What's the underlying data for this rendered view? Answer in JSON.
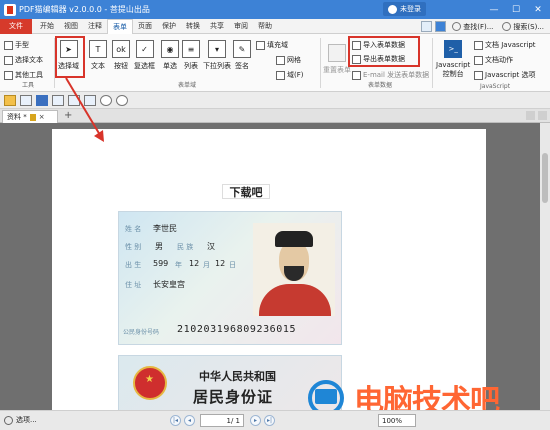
{
  "titlebar": {
    "title": "PDF猫编辑器 v2.0.0.0 - 菩提山出品",
    "login": "未登录",
    "minimize_glyph": "—",
    "maximize_glyph": "☐",
    "close_glyph": "✕"
  },
  "menubar": {
    "file": "文件",
    "tabs": [
      "开始",
      "视图",
      "注释",
      "表单",
      "页面",
      "保护",
      "转换",
      "共享",
      "审阅",
      "帮助"
    ],
    "active_tab": "表单",
    "find": "查找(F)...",
    "search": "搜索(S)..."
  },
  "ribbon": {
    "tools": {
      "hand": "手型",
      "select_text": "选择文本",
      "other_tools": "其他工具",
      "group_label": "工具"
    },
    "form_fields": {
      "select_field": "选择域",
      "text": "文本",
      "button": "按钮",
      "checkbox": "复选框",
      "radio": "单选",
      "list": "列表",
      "dropdown": "下拉列表",
      "signature": "签名",
      "fill_field": "填充域",
      "grid": "网格",
      "field_f": "域(F)",
      "group_label": "表单域"
    },
    "form_data": {
      "reset": "重置表单",
      "import": "导入表单数据",
      "export": "导出表单数据",
      "email": "E-mail 发送表单数据",
      "group_label": "表单数据"
    },
    "javascript": {
      "console_line1": "Javascript",
      "console_line2": "控制台",
      "doc_js": "文档 Javascript",
      "doc_action": "文档动作",
      "js_options": "Javascript 选项",
      "group_label": "JavaScript"
    }
  },
  "doctab": {
    "label": "资料 *",
    "close": "×",
    "new_tab": "+"
  },
  "page": {
    "heading": "下载吧"
  },
  "idcard": {
    "name_label": "姓  名",
    "name": "李世民",
    "sex_label": "性  别",
    "sex": "男",
    "ethnicity_label": "民  族",
    "ethnicity": "汉",
    "birth_label": "出  生",
    "birth_year": "599",
    "birth_year_label": "年",
    "birth_month": "12",
    "birth_month_label": "月",
    "birth_day": "12",
    "birth_day_label": "日",
    "address_label": "住  址",
    "address": "长安皇宫",
    "id_label": "公民身份号码",
    "id_number": "210203196809236015"
  },
  "idcard_back": {
    "country": "中华人民共和国",
    "card_title": "居民身份证"
  },
  "watermark": {
    "text": "电脑技术吧"
  },
  "statusbar": {
    "options": "选项...",
    "page_value": "1",
    "page_total": "/ 1",
    "zoom": "100%"
  }
}
